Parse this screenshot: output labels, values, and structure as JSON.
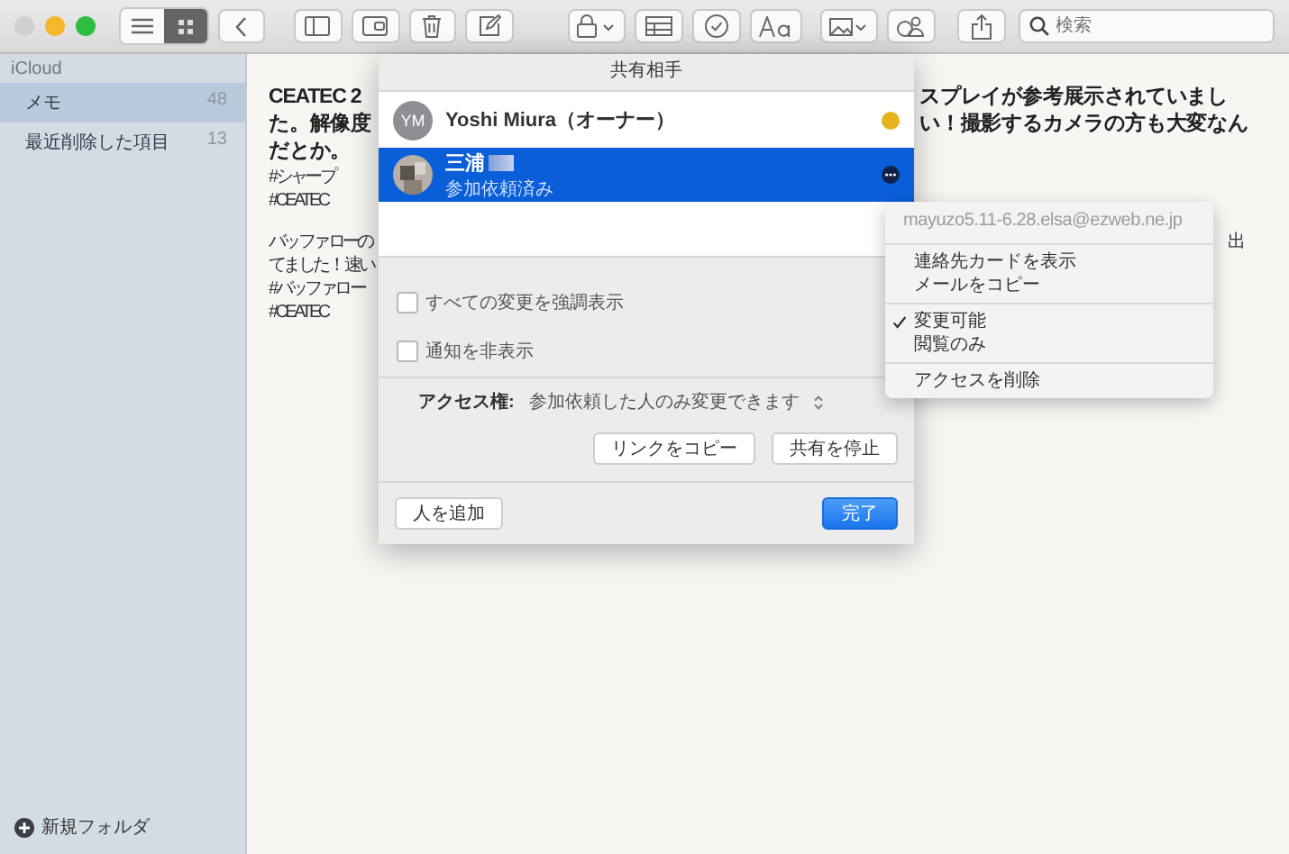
{
  "toolbar": {
    "view_modes": [
      {
        "selected": false
      },
      {
        "selected": true
      }
    ],
    "search": {
      "placeholder": "検索"
    }
  },
  "sidebar": {
    "account": "iCloud",
    "folders": [
      {
        "name": "メモ",
        "count": "48",
        "selected": true
      },
      {
        "name": "最近削除した項目",
        "count": "13",
        "selected": false
      }
    ],
    "new_folder": "新規フォルダ"
  },
  "note": {
    "lines": [
      {
        "kind": "bold",
        "left": "CEATEC 2",
        "right": "スプレイが参考展示されていまし"
      },
      {
        "kind": "bold",
        "left": "た。解像度",
        "right": "い！撮影するカメラの方も大変なん"
      },
      {
        "kind": "bold",
        "left": "だとか。"
      },
      {
        "kind": "plain",
        "left": "#シャープ"
      },
      {
        "kind": "plain",
        "left": "#CEATEC"
      },
      {
        "kind": "blank"
      },
      {
        "kind": "plain",
        "left": "バッファローの",
        "right": "出"
      },
      {
        "kind": "plain",
        "left": "てました！ 速い"
      },
      {
        "kind": "plain",
        "left": "#バッファロー"
      },
      {
        "kind": "plain",
        "left": "#CEATEC"
      }
    ]
  },
  "share_sheet": {
    "title": "共有相手",
    "participants": [
      {
        "kind": "initials",
        "initials": "YM",
        "name": "Yoshi Miura（オーナー）",
        "selected": false,
        "color": "#e6b31e"
      },
      {
        "kind": "photo",
        "name": "三浦",
        "status": "参加依頼済み",
        "selected": true
      }
    ],
    "options": [
      {
        "label": "すべての変更を強調表示",
        "checked": false
      },
      {
        "label": "通知を非表示",
        "checked": false
      }
    ],
    "access_label": "アクセス権:",
    "access_value": "参加依頼した人のみ変更できます",
    "copy_link": "リンクをコピー",
    "stop_sharing": "共有を停止",
    "add_person": "人を追加",
    "done": "完了"
  },
  "context_menu": {
    "email": "mayuzo5.11-6.28.elsa@ezweb.ne.jp",
    "email_disabled": true,
    "groups": [
      [
        {
          "label": "連絡先カードを表示",
          "checked": false
        },
        {
          "label": "メールをコピー",
          "checked": false
        }
      ],
      [
        {
          "label": "変更可能",
          "checked": true
        },
        {
          "label": "閲覧のみ",
          "checked": false
        }
      ],
      [
        {
          "label": "アクセスを削除",
          "checked": false
        }
      ]
    ]
  }
}
